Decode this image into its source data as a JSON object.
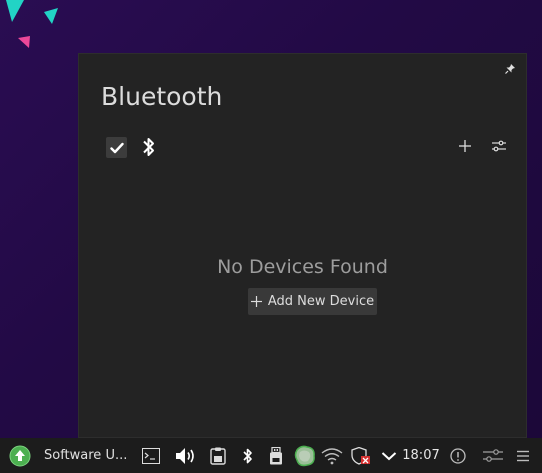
{
  "desktop": {
    "decoration_colors": [
      "#22d3c5",
      "#ec4899"
    ]
  },
  "popup": {
    "title": "Bluetooth",
    "bluetooth_enabled": true,
    "empty_message": "No Devices Found",
    "add_device_label": "Add New Device",
    "icons": {
      "pin": "pin-icon",
      "toggle": "checkmark-icon",
      "bluetooth": "bluetooth-icon",
      "add": "plus-icon",
      "settings": "sliders-icon"
    }
  },
  "taskbar": {
    "launcher_icon": "arrow-up-circle-icon",
    "active_task_label": "Software U...",
    "tray_icons": [
      "terminal-icon",
      "volume-icon",
      "clipboard-icon",
      "bluetooth-icon",
      "usb-drive-icon",
      "updates-icon",
      "wifi-icon",
      "shield-alert-icon",
      "chevron-down-icon"
    ],
    "clock": "18:07",
    "right_icons": [
      "info-icon",
      "sliders-icon",
      "menu-icon"
    ],
    "accent_color": "#4caf50"
  }
}
